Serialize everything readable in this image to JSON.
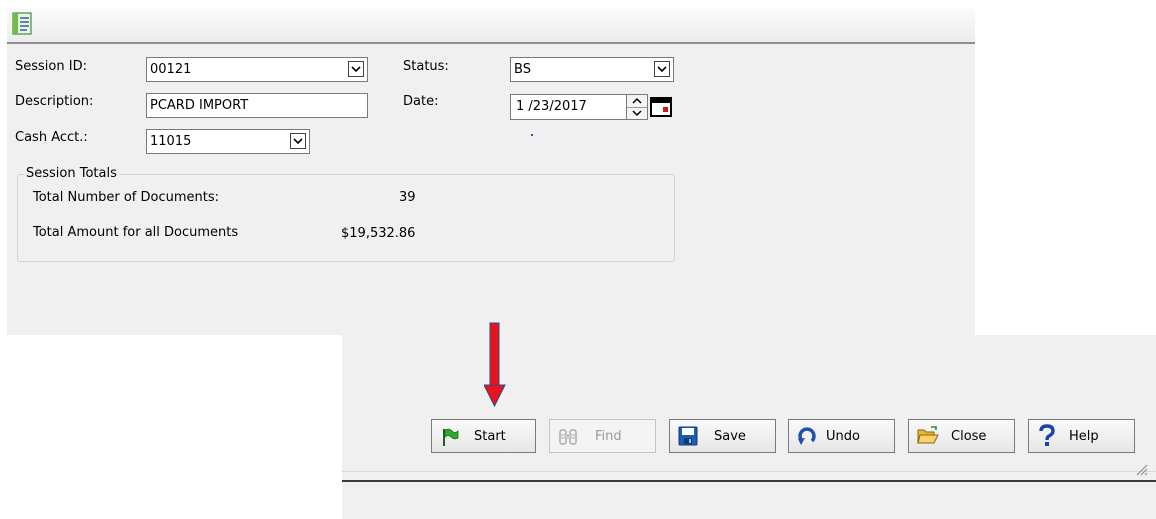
{
  "form": {
    "session_id": {
      "label": "Session ID:",
      "value": "00121"
    },
    "description": {
      "label": "Description:",
      "value": "PCARD IMPORT"
    },
    "cash_acct": {
      "label": "Cash Acct.:",
      "value": "11015"
    },
    "status": {
      "label": "Status:",
      "value": "BS"
    },
    "date": {
      "label": "Date:",
      "value": "1 /23/2017"
    }
  },
  "session_totals": {
    "title": "Session Totals",
    "documents_label": "Total Number of Documents:",
    "documents_value": "39",
    "amount_label": "Total Amount for all Documents",
    "amount_value": "$19,532.86"
  },
  "toolbar": {
    "start_label": "Start",
    "find_label": "Find",
    "save_label": "Save",
    "undo_label": "Undo",
    "close_label": "Close",
    "help_label": "Help"
  },
  "icons": {
    "title": "document-icon",
    "start": "flag-icon",
    "find": "binoculars-icon",
    "save": "floppy-disk-icon",
    "undo": "undo-arrow-icon",
    "close": "folder-icon",
    "help": "question-mark-icon",
    "annotation": "red-down-arrow-icon"
  },
  "colors": {
    "panel": "#f0f0f0",
    "annotation_arrow": "#e8141b",
    "help_icon": "#1a3fb0",
    "start_flag": "#2ea82e"
  }
}
